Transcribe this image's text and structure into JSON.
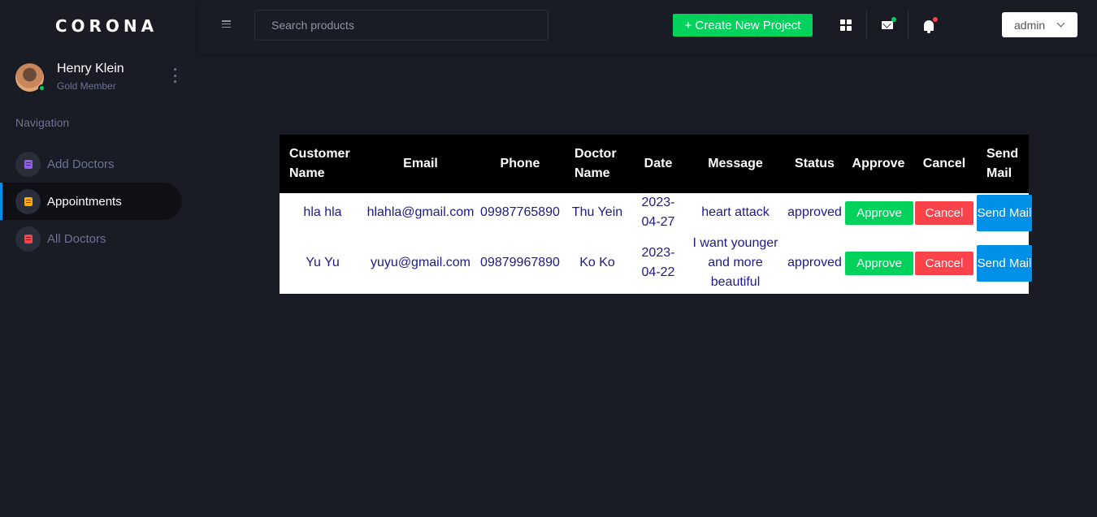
{
  "brand": {
    "name": "CORONA"
  },
  "profile": {
    "name": "Henry Klein",
    "role": "Gold Member"
  },
  "navigation": {
    "label": "Navigation",
    "items": [
      {
        "label": "Add Doctors",
        "icon": "document-icon",
        "color": "#8f5fe8",
        "active": false
      },
      {
        "label": "Appointments",
        "icon": "document-icon",
        "color": "#ffab00",
        "active": true
      },
      {
        "label": "All Doctors",
        "icon": "document-icon",
        "color": "#fc424a",
        "active": false
      }
    ]
  },
  "topbar": {
    "search_placeholder": "Search products",
    "create_label": "+ Create New Project",
    "user_label": "admin",
    "mail_badge_color": "#00d25b",
    "bell_badge_color": "#fc424a"
  },
  "table": {
    "headers": {
      "customer_name": "Customer Name",
      "email": "Email",
      "phone": "Phone",
      "doctor_name": "Doctor Name",
      "date": "Date",
      "message": "Message",
      "status": "Status",
      "approve": "Approve",
      "cancel": "Cancel",
      "send_mail": "Send Mail"
    },
    "rows": [
      {
        "customer_name": "hla hla",
        "email": "hlahla@gmail.com",
        "phone": "09987765890",
        "doctor_name": "Thu Yein",
        "date": "2023-04-27",
        "message": "heart attack",
        "status": "approved",
        "approve_label": "Approve",
        "cancel_label": "Cancel",
        "send_mail_label": "Send Mail"
      },
      {
        "customer_name": "Yu Yu",
        "email": "yuyu@gmail.com",
        "phone": "09879967890",
        "doctor_name": "Ko Ko",
        "date": "2023-04-22",
        "message": "I want younger and more beautiful",
        "status": "approved",
        "approve_label": "Approve",
        "cancel_label": "Cancel",
        "send_mail_label": "Send Mail"
      }
    ]
  }
}
